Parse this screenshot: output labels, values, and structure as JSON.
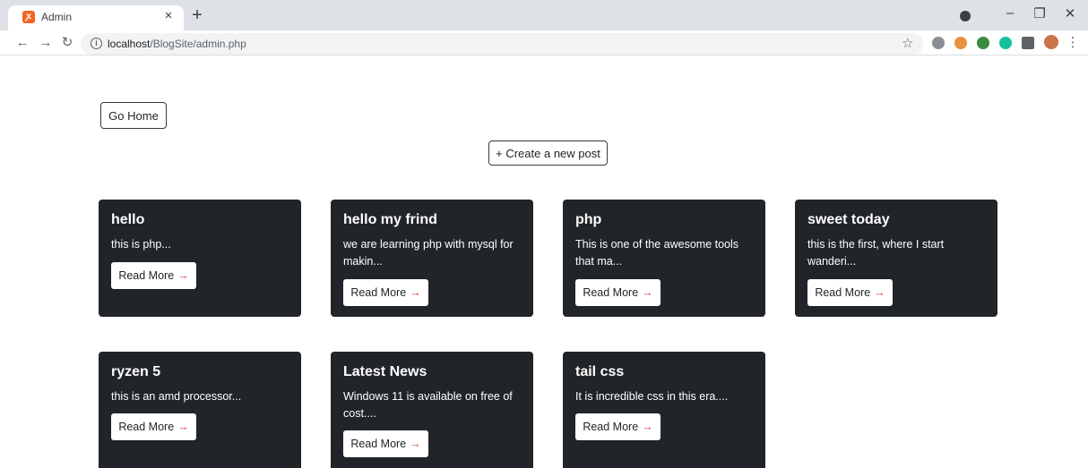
{
  "browser": {
    "tab_title": "Admin",
    "tab_close": "×",
    "new_tab": "+",
    "url_host": "localhost",
    "url_path": "/BlogSite/admin.php",
    "window_controls": {
      "minimize": "–",
      "restore": "❐",
      "close": "✕"
    }
  },
  "page": {
    "go_home_label": "Go Home",
    "create_post_label": "+ Create a new post",
    "read_more_label": "Read More",
    "read_more_arrow": "→"
  },
  "posts": [
    {
      "title": "hello",
      "excerpt": "this is php..."
    },
    {
      "title": "hello my frind",
      "excerpt": "we are learning php with mysql for makin..."
    },
    {
      "title": "php",
      "excerpt": "This is one of the awesome tools that ma..."
    },
    {
      "title": "sweet today",
      "excerpt": "this is the first, where I start wanderi..."
    },
    {
      "title": "ryzen 5",
      "excerpt": "this is an amd processor..."
    },
    {
      "title": "Latest News",
      "excerpt": "Windows 11 is available on free of cost...."
    },
    {
      "title": "tail css",
      "excerpt": "It is incredible css in this era...."
    }
  ],
  "colors": {
    "card_bg": "#212529",
    "arrow": "#dc3545",
    "favicon": "#f26522"
  }
}
